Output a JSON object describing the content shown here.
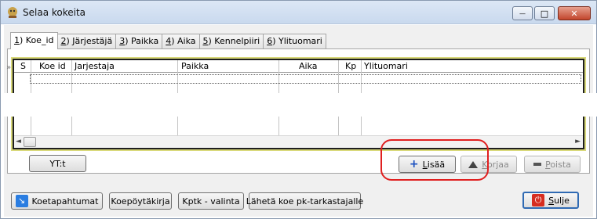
{
  "window": {
    "title": "Selaa kokeita",
    "app_icon": "app-icon",
    "min_icon": "minimize-icon",
    "max_icon": "maximize-icon",
    "close_icon": "close-icon",
    "close_glyph": "✕",
    "max_glyph": "□",
    "min_glyph": "—"
  },
  "tabs": [
    {
      "num": "1",
      "label": ") Koe_id"
    },
    {
      "num": "2",
      "label": ") Järjestäjä"
    },
    {
      "num": "3",
      "label": ") Paikka"
    },
    {
      "num": "4",
      "label": ") Aika"
    },
    {
      "num": "5",
      "label": ") Kennelpiiri"
    },
    {
      "num": "6",
      "label": ") Ylituomari"
    }
  ],
  "grid": {
    "row_marker": "»",
    "columns": [
      "S",
      "Koe id",
      "Jarjestaja",
      "Paikka",
      "Aika",
      "Kp",
      "Ylituomari"
    ],
    "left_arrow": "◄",
    "right_arrow": "►"
  },
  "buttons": {
    "yt": "YT:t",
    "lisaa_u": "L",
    "lisaa_rest": "isää",
    "korjaa_u": "K",
    "korjaa_rest": "orjaa",
    "poista_u": "P",
    "poista_rest": "oista",
    "koetapahtumat": "Koetapahtumat",
    "koepoytakirja": "Koepöytäkirja",
    "kptk": "Kptk - valinta",
    "laheta": "Lähetä koe pk-tarkastajalle",
    "sulje_u": "S",
    "sulje_rest": "ulje"
  },
  "icons": {
    "plus": "+",
    "arrow": "↘",
    "power": "⏻"
  },
  "colors": {
    "highlight": "#e02020",
    "accent": "#2a7de1"
  }
}
